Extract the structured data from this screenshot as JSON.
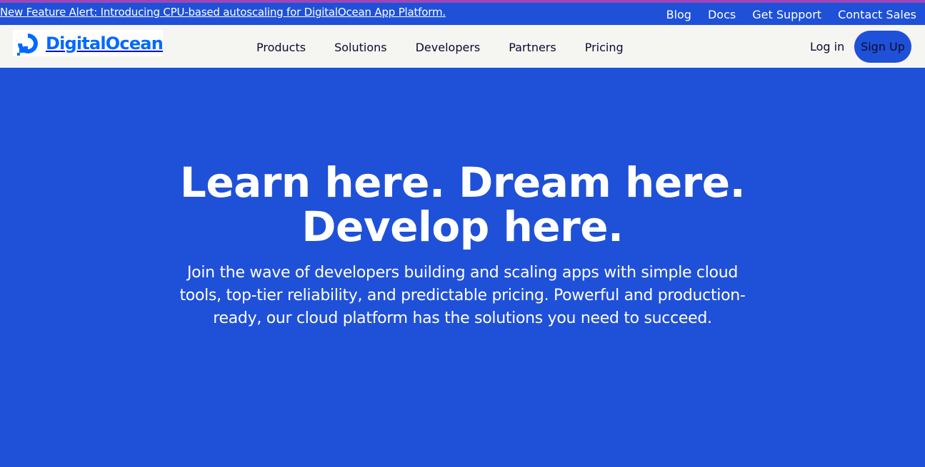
{
  "announcement": {
    "text": "New Feature Alert: Introducing CPU-based autoscaling for DigitalOcean App Platform."
  },
  "utility_nav": [
    "Blog",
    "Docs",
    "Get Support",
    "Contact Sales"
  ],
  "header": {
    "logo_text": "DigitalOcean",
    "menu": [
      "Products",
      "Solutions",
      "Developers",
      "Partners",
      "Pricing"
    ],
    "login_label": "Log in",
    "signup_label": "Sign Up"
  },
  "hero": {
    "title_line1": "Learn here. Dream here.",
    "title_line2": "Develop here.",
    "subtitle": "Join the wave of developers building and scaling apps with simple cloud tools, top-tier reliability, and predictable pricing. Powerful and production-ready, our cloud platform has the solutions you need to succeed."
  },
  "colors": {
    "brand_blue": "#0069ff",
    "hero_background": "#1f50d8",
    "nav_background": "#f5f5f2",
    "top_accent": "#9f45b5"
  },
  "icons": {
    "logo": "digitalocean-logo-icon"
  }
}
